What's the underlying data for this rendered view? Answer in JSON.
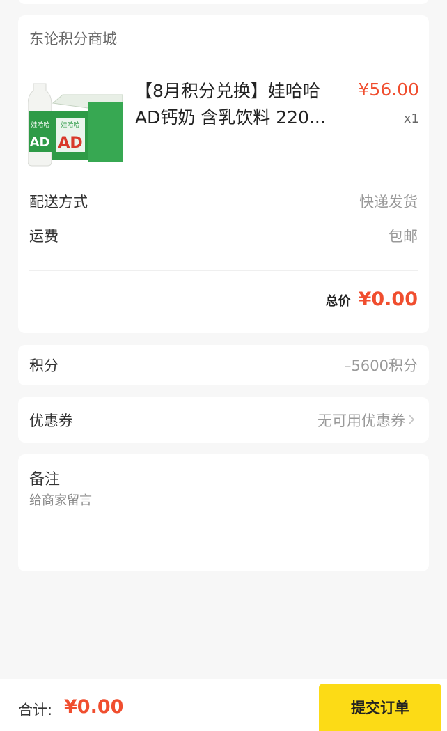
{
  "order": {
    "shop_name": "东论积分商城",
    "product": {
      "title_line1": "【8月积分兑换】娃哈哈",
      "title_line2": "AD钙奶 含乳饮料 220...",
      "price": "¥56.00",
      "quantity": "x1",
      "image_brand_text": "娃哈哈",
      "image_product_text": "AD"
    },
    "delivery_label": "配送方式",
    "delivery_value": "快递发货",
    "shipping_label": "运费",
    "shipping_value": "包邮",
    "total_label": "总价",
    "total_value": "¥0.00"
  },
  "points": {
    "label": "积分",
    "value": "–5600积分"
  },
  "coupon": {
    "label": "优惠券",
    "value": "无可用优惠券"
  },
  "note": {
    "label": "备注",
    "placeholder": "给商家留言"
  },
  "bottom": {
    "sum_label": "合计:",
    "sum_value": "¥0.00",
    "submit_label": "提交订单"
  },
  "colors": {
    "price_red": "#f04e2f",
    "submit_yellow": "#fcdb16",
    "product_green": "#2e9b47"
  }
}
